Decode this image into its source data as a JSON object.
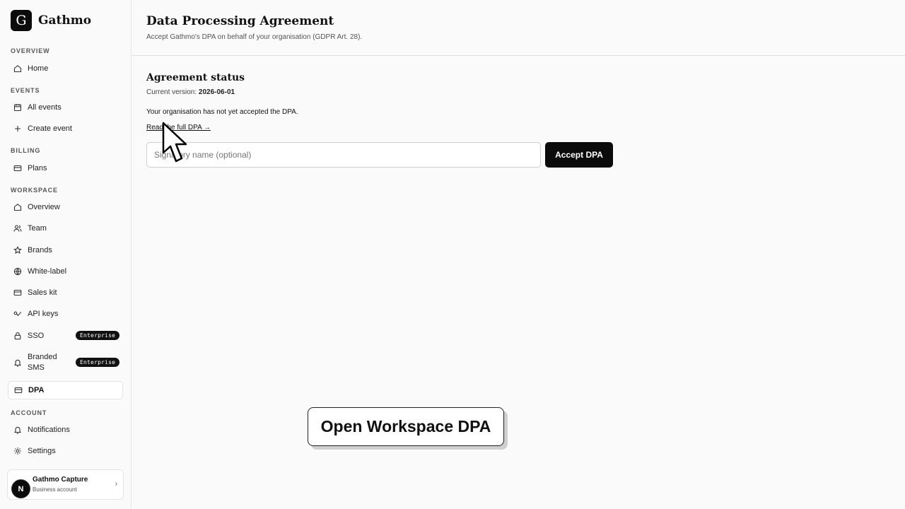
{
  "app": {
    "logo_letter": "G",
    "name": "Gathmo"
  },
  "sidebar": {
    "sections": {
      "overview": "OVERVIEW",
      "events": "EVENTS",
      "billing": "BILLING",
      "workspace": "WORKSPACE",
      "account": "ACCOUNT"
    },
    "items": {
      "home": {
        "label": "Home",
        "icon": "home-icon"
      },
      "all_events": {
        "label": "All events",
        "icon": "calendar-icon"
      },
      "create_event": {
        "label": "Create event",
        "icon": "plus-icon"
      },
      "plans": {
        "label": "Plans",
        "icon": "card-icon"
      },
      "ws_overview": {
        "label": "Overview",
        "icon": "home-icon"
      },
      "team": {
        "label": "Team",
        "icon": "users-icon"
      },
      "brands": {
        "label": "Brands",
        "icon": "star-icon"
      },
      "white_label": {
        "label": "White-label",
        "icon": "globe-icon"
      },
      "sales_kit": {
        "label": "Sales kit",
        "icon": "card-icon"
      },
      "api_keys": {
        "label": "API keys",
        "icon": "key-icon"
      },
      "sso": {
        "label": "SSO",
        "icon": "lock-icon",
        "badge": "Enterprise"
      },
      "branded_sms": {
        "label": "Branded SMS",
        "icon": "bell-icon",
        "badge": "Enterprise"
      },
      "dpa": {
        "label": "DPA",
        "icon": "card-icon",
        "active": true
      },
      "notifications": {
        "label": "Notifications",
        "icon": "bell-icon"
      },
      "settings": {
        "label": "Settings",
        "icon": "gear-icon"
      }
    }
  },
  "account": {
    "avatar_letter": "N",
    "name": "Gathmo Capture",
    "type": "Business account"
  },
  "header": {
    "title": "Data Processing Agreement",
    "subtitle": "Accept Gathmo's DPA on behalf of your organisation (GDPR Art. 28)."
  },
  "agreement": {
    "section_title": "Agreement status",
    "version_label": "Current version:",
    "version_value": "2026-06-01",
    "status_text": "Your organisation has not yet accepted the DPA.",
    "link_text": "Read the full DPA →",
    "signatory_placeholder": "Signatory name (optional)",
    "signatory_value": "",
    "accept_label": "Accept DPA"
  },
  "callout": {
    "text": "Open Workspace DPA"
  },
  "colors": {
    "accent": "#0b0b0b",
    "background": "#fafafa",
    "border": "#e5e5e5"
  }
}
